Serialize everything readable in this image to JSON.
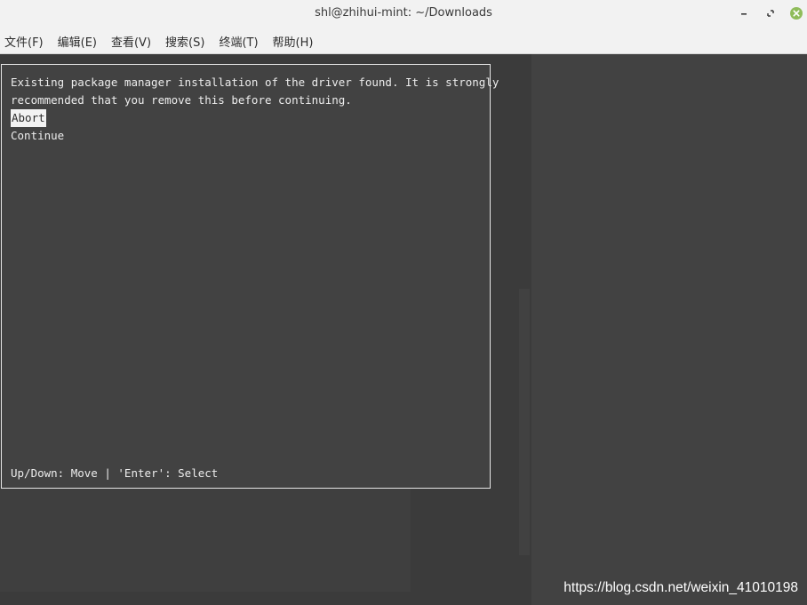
{
  "window": {
    "title": "shl@zhihui-mint: ~/Downloads",
    "controls": {
      "minimize_icon": "minimize-icon",
      "maximize_icon": "maximize-icon",
      "close_icon": "close-icon"
    }
  },
  "menubar": {
    "items": [
      {
        "label": "文件(F)"
      },
      {
        "label": "编辑(E)"
      },
      {
        "label": "查看(V)"
      },
      {
        "label": "搜索(S)"
      },
      {
        "label": "终端(T)"
      },
      {
        "label": "帮助(H)"
      }
    ]
  },
  "dialog": {
    "message_line1": "Existing package manager installation of the driver found. It is strongly",
    "message_line2": "recommended that you remove this before continuing.",
    "options": [
      {
        "label": "Abort",
        "selected": true
      },
      {
        "label": "Continue",
        "selected": false
      }
    ],
    "help": "Up/Down: Move | 'Enter': Select"
  },
  "watermark": "https://blog.csdn.net/weixin_41010198",
  "colors": {
    "titlebar_bg": "#f2f2f2",
    "terminal_bg": "#3b3b3b",
    "dialog_border": "#e6e6e6",
    "close_button": "#8fbc5a"
  }
}
